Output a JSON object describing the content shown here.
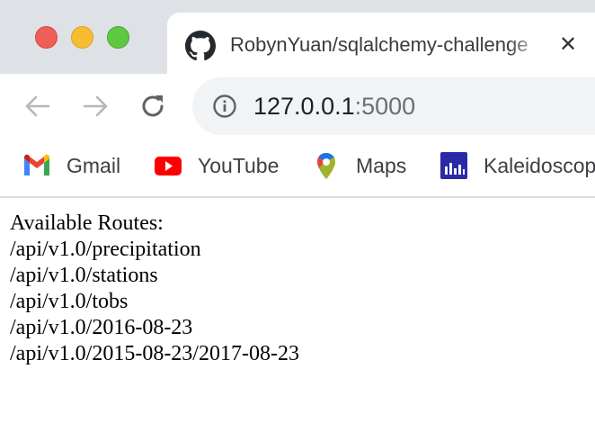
{
  "window": {
    "controls": [
      "close",
      "minimize",
      "maximize"
    ]
  },
  "tab": {
    "title": "RobynYuan/sqlalchemy-challenge",
    "favicon": "github-icon",
    "close_label": "✕"
  },
  "toolbar": {
    "back_icon": "arrow-left-icon",
    "forward_icon": "arrow-right-icon",
    "reload_icon": "reload-icon",
    "info_icon": "info-icon",
    "url_host": "127.0.0.1",
    "url_port": ":5000"
  },
  "bookmarks": [
    {
      "label": "Gmail",
      "icon": "gmail-icon"
    },
    {
      "label": "YouTube",
      "icon": "youtube-icon"
    },
    {
      "label": "Maps",
      "icon": "maps-icon"
    },
    {
      "label": "Kaleidoscope",
      "icon": "kaleidoscope-icon"
    }
  ],
  "page": {
    "heading": "Available Routes:",
    "routes": [
      "/api/v1.0/precipitation",
      "/api/v1.0/stations",
      "/api/v1.0/tobs",
      "/api/v1.0/2016-08-23",
      "/api/v1.0/2015-08-23/2017-08-23"
    ]
  },
  "colors": {
    "tabstrip_bg": "#dee1e6",
    "omnibox_bg": "#f1f3f4",
    "traffic_red": "#ee5f57",
    "traffic_yellow": "#f5bd2f",
    "traffic_green": "#5ec840"
  }
}
